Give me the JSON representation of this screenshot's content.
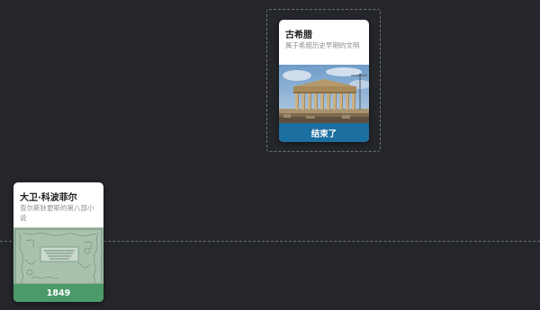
{
  "timeline": {
    "cards": [
      {
        "title": "古希腊",
        "description": "属于希腊历史早期的文明",
        "image_icon": "parthenon-photo",
        "footer": "结束了",
        "footer_color": "#1c6fa1"
      },
      {
        "title": "大卫·科波菲尔",
        "description": "查尔斯狄更斯的第八部小说",
        "image_icon": "book-title-page-engraving",
        "footer": "1849",
        "footer_color": "#4c9a6a"
      }
    ]
  }
}
